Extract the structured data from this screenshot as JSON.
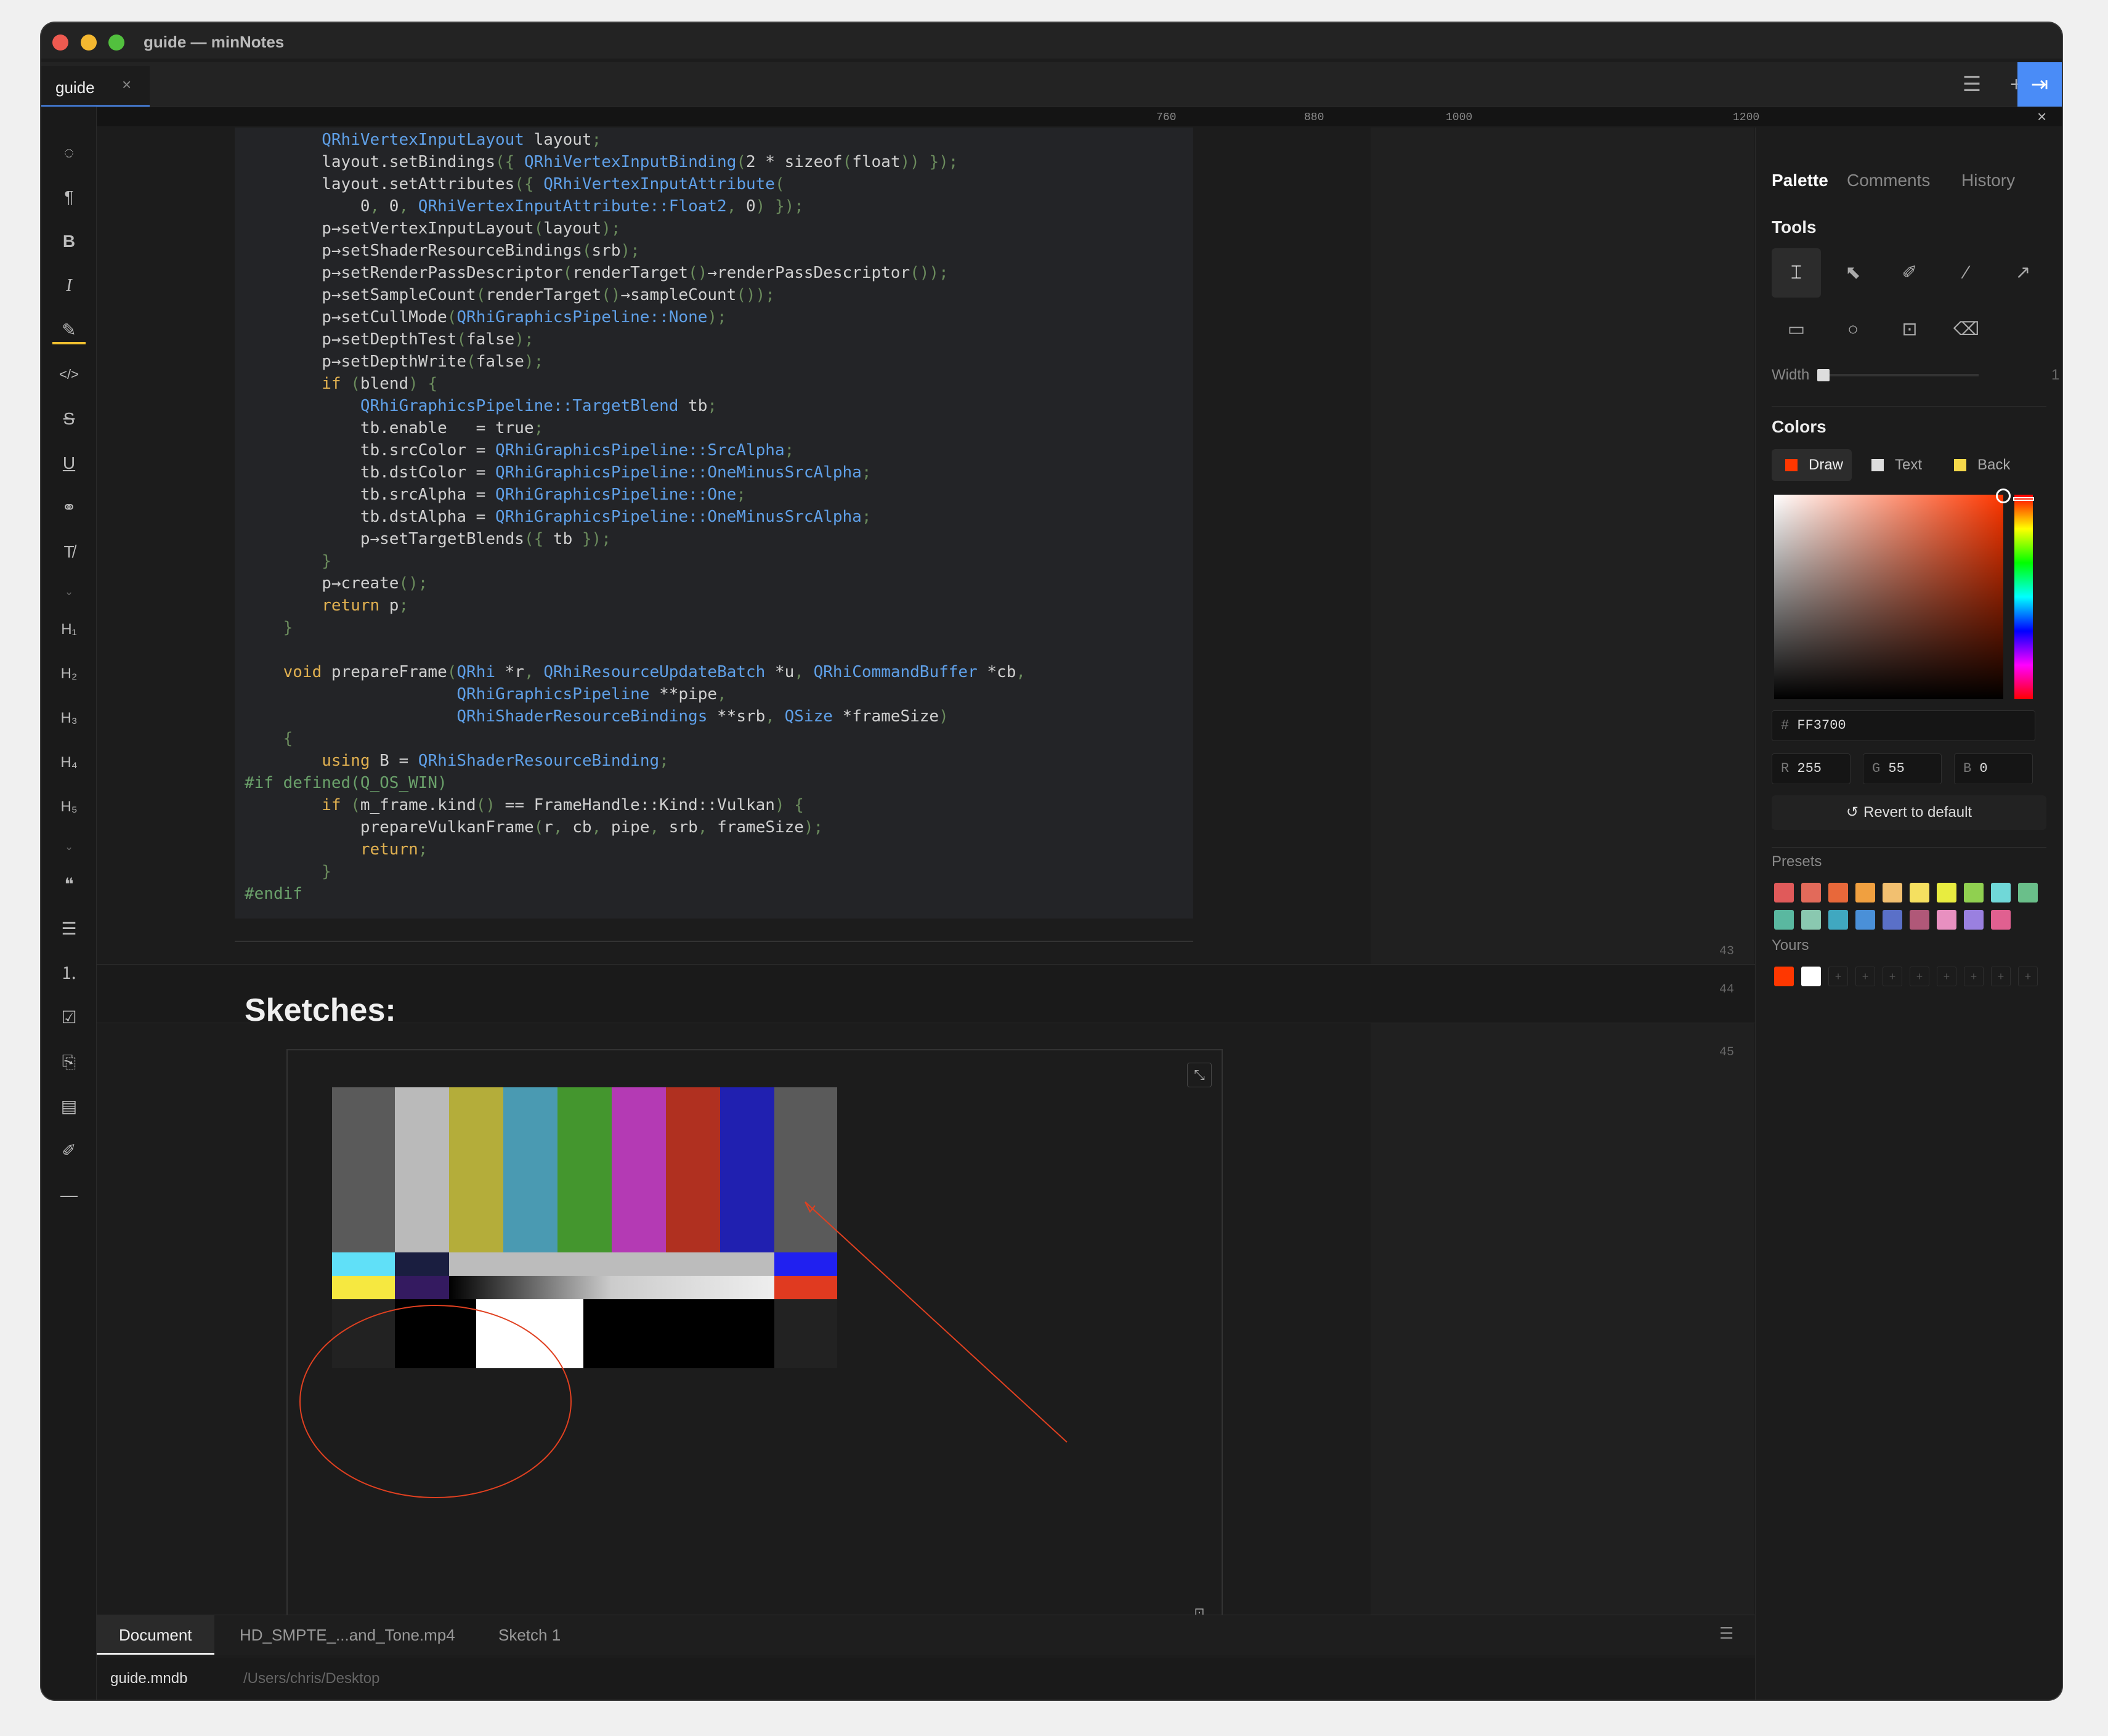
{
  "window": {
    "title": "guide — minNotes"
  },
  "tab": {
    "label": "guide",
    "close": "×"
  },
  "ruler": [
    "760",
    "880",
    "1000",
    "1200"
  ],
  "code_lines": [
    "        QRhiVertexInputLayout layout;",
    "        layout.setBindings({ QRhiVertexInputBinding(2 * sizeof(float)) });",
    "        layout.setAttributes({ QRhiVertexInputAttribute(",
    "            0, 0, QRhiVertexInputAttribute::Float2, 0) });",
    "        p→setVertexInputLayout(layout);",
    "        p→setShaderResourceBindings(srb);",
    "        p→setRenderPassDescriptor(renderTarget()→renderPassDescriptor());",
    "        p→setSampleCount(renderTarget()→sampleCount());",
    "        p→setCullMode(QRhiGraphicsPipeline::None);",
    "        p→setDepthTest(false);",
    "        p→setDepthWrite(false);",
    "        if (blend) {",
    "            QRhiGraphicsPipeline::TargetBlend tb;",
    "            tb.enable   = true;",
    "            tb.srcColor = QRhiGraphicsPipeline::SrcAlpha;",
    "            tb.dstColor = QRhiGraphicsPipeline::OneMinusSrcAlpha;",
    "            tb.srcAlpha = QRhiGraphicsPipeline::One;",
    "            tb.dstAlpha = QRhiGraphicsPipeline::OneMinusSrcAlpha;",
    "            p→setTargetBlends({ tb });",
    "        }",
    "        p→create();",
    "        return p;",
    "    }",
    "",
    "    void prepareFrame(QRhi *r, QRhiResourceUpdateBatch *u, QRhiCommandBuffer *cb,",
    "                      QRhiGraphicsPipeline **pipe,",
    "                      QRhiShaderResourceBindings **srb, QSize *frameSize)",
    "    {",
    "        using B = QRhiShaderResourceBinding;",
    "#if defined(Q_OS_WIN)",
    "        if (m_frame.kind() == FrameHandle::Kind::Vulkan) {",
    "            prepareVulkanFrame(r, cb, pipe, srb, frameSize);",
    "            return;",
    "        }",
    "#endif"
  ],
  "line_numbers": [
    "43",
    "44",
    "45"
  ],
  "heading": "Sketches:",
  "bottom_tabs": [
    "Document",
    "HD_SMPTE_...and_Tone.mp4",
    "Sketch 1"
  ],
  "status": {
    "file": "guide.mndb",
    "path": "/Users/chris/Desktop"
  },
  "panel": {
    "tabs": [
      "Palette",
      "Comments",
      "History"
    ],
    "tools_title": "Tools",
    "width_label": "Width",
    "width_value": "1",
    "colors_title": "Colors",
    "color_targets": [
      "Draw",
      "Text",
      "Back"
    ],
    "hex_prefix": "#",
    "hex": "FF3700",
    "r_label": "R",
    "r": "255",
    "g_label": "G",
    "g": "55",
    "b_label": "B",
    "b": "0",
    "revert": "Revert to default",
    "presets_title": "Presets",
    "yours_title": "Yours",
    "presets": [
      "#e05a5a",
      "#e26a5a",
      "#e8683a",
      "#f0a040",
      "#f2c070",
      "#f5e060",
      "#e8ec40",
      "#90d050",
      "#70d8d8",
      "#6abf8a",
      "#5ab8a0",
      "#8ac8b0",
      "#40a8c0",
      "#4a90d8",
      "#5a70c8",
      "#b05878",
      "#e890c0",
      "#9a80e0",
      "#e06090"
    ],
    "yours": [
      "#ff3700",
      "#ffffff"
    ]
  },
  "colors": {
    "accent": "#4a8cf7",
    "draw": "#ff3700",
    "background": "#1c1c1c"
  }
}
